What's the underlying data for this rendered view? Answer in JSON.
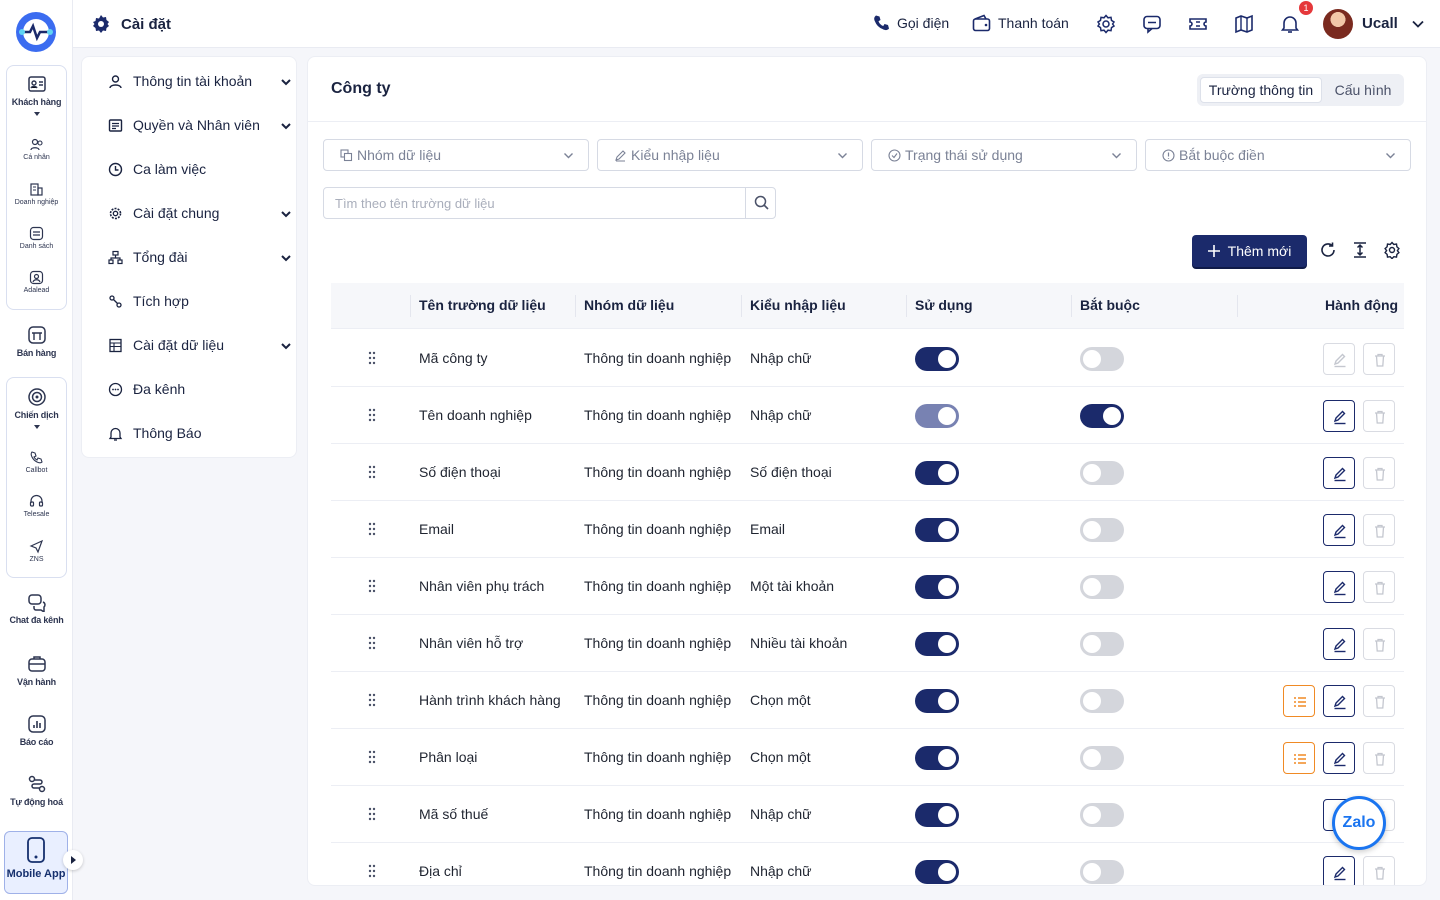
{
  "rail": {
    "items": [
      {
        "label": "Khách hàng"
      },
      {
        "label": "Cá nhân"
      },
      {
        "label": "Doanh nghiệp"
      },
      {
        "label": "Danh sách"
      },
      {
        "label": "Adalead"
      },
      {
        "label": "Bán hàng"
      },
      {
        "label": "Chiến dịch"
      },
      {
        "label": "Callbot"
      },
      {
        "label": "Telesale"
      },
      {
        "label": "ZNS"
      },
      {
        "label": "Chat đa kênh"
      },
      {
        "label": "Vận hành"
      },
      {
        "label": "Báo cáo"
      },
      {
        "label": "Tự động hoá"
      },
      {
        "label": "Mobile App"
      }
    ]
  },
  "header": {
    "title": "Cài đặt",
    "call_label": "Gọi điện",
    "payment_label": "Thanh toán",
    "notification_count": "1",
    "user_name": "Ucall"
  },
  "sidemenu": {
    "items": [
      {
        "label": "Thông tin tài khoản",
        "icon": "user-icon",
        "expandable": true
      },
      {
        "label": "Quyền và Nhân viên",
        "icon": "id-card-icon",
        "expandable": true
      },
      {
        "label": "Ca làm việc",
        "icon": "clock-icon",
        "expandable": false
      },
      {
        "label": "Cài đặt chung",
        "icon": "gear-icon",
        "expandable": true
      },
      {
        "label": "Tổng đài",
        "icon": "network-icon",
        "expandable": true
      },
      {
        "label": "Tích hợp",
        "icon": "link-icon",
        "expandable": false
      },
      {
        "label": "Cài đặt dữ liệu",
        "icon": "table-icon",
        "expandable": true
      },
      {
        "label": "Đa kênh",
        "icon": "chat-icon",
        "expandable": false
      },
      {
        "label": "Thông Báo",
        "icon": "bell-icon",
        "expandable": false
      }
    ]
  },
  "panel": {
    "title": "Công ty",
    "tabs": [
      {
        "label": "Trường thông tin"
      },
      {
        "label": "Cấu hình"
      }
    ],
    "filters": [
      {
        "label": "Nhóm dữ liệu"
      },
      {
        "label": "Kiểu nhập liệu"
      },
      {
        "label": "Trạng thái sử dụng"
      },
      {
        "label": "Bắt buộc điền"
      }
    ],
    "search_placeholder": "Tìm theo tên trường dữ liệu",
    "add_label": "Thêm mới"
  },
  "table": {
    "headers": [
      "Tên trường dữ liệu",
      "Nhóm dữ liệu",
      "Kiểu nhập liệu",
      "Sử dụng",
      "Bắt buộc",
      "Hành động"
    ],
    "rows": [
      {
        "name": "Mã công ty",
        "group": "Thông tin doanh nghiệp",
        "type": "Nhập chữ",
        "used": "on",
        "required": "off",
        "has_options": false,
        "editable": false
      },
      {
        "name": "Tên doanh nghiệp",
        "group": "Thông tin doanh nghiệp",
        "type": "Nhập chữ",
        "used": "locked",
        "required": "on",
        "has_options": false,
        "editable": true
      },
      {
        "name": "Số điện thoại",
        "group": "Thông tin doanh nghiệp",
        "type": "Số điện thoại",
        "used": "on",
        "required": "off",
        "has_options": false,
        "editable": true
      },
      {
        "name": "Email",
        "group": "Thông tin doanh nghiệp",
        "type": "Email",
        "used": "on",
        "required": "off",
        "has_options": false,
        "editable": true
      },
      {
        "name": "Nhân viên phụ trách",
        "group": "Thông tin doanh nghiệp",
        "type": "Một tài khoản",
        "used": "on",
        "required": "off",
        "has_options": false,
        "editable": true
      },
      {
        "name": "Nhân viên hỗ trợ",
        "group": "Thông tin doanh nghiệp",
        "type": "Nhiều tài khoản",
        "used": "on",
        "required": "off",
        "has_options": false,
        "editable": true
      },
      {
        "name": "Hành trình khách hàng",
        "group": "Thông tin doanh nghiệp",
        "type": "Chọn một",
        "used": "on",
        "required": "off",
        "has_options": true,
        "editable": true
      },
      {
        "name": "Phân loại",
        "group": "Thông tin doanh nghiệp",
        "type": "Chọn một",
        "used": "on",
        "required": "off",
        "has_options": true,
        "editable": true
      },
      {
        "name": "Mã số thuế",
        "group": "Thông tin doanh nghiệp",
        "type": "Nhập chữ",
        "used": "on",
        "required": "off",
        "has_options": false,
        "editable": true
      },
      {
        "name": "Địa chỉ",
        "group": "Thông tin doanh nghiệp",
        "type": "Nhập chữ",
        "used": "on",
        "required": "off",
        "has_options": false,
        "editable": true
      }
    ]
  },
  "zalo": {
    "label": "Zalo"
  },
  "colors": {
    "primary": "#1b2a6b",
    "accent_orange": "#f08a24",
    "badge_red": "#e5383b",
    "zalo_blue": "#1b75f0"
  }
}
